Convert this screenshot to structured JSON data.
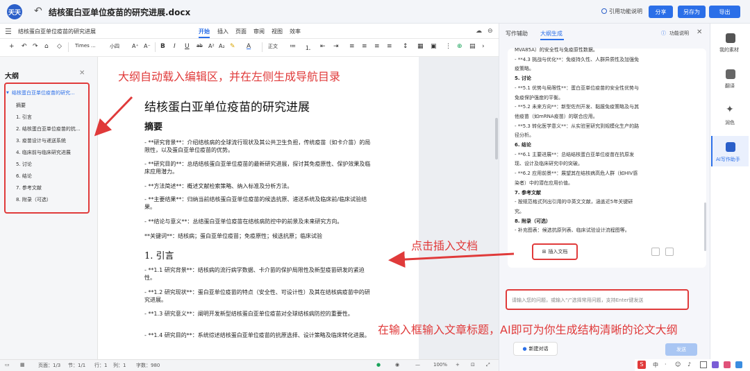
{
  "app": {
    "title": "结核蛋白亚单位疫苗的研究进展.docx",
    "logo_text": "天天"
  },
  "topbar": {
    "cite_help": "引用功能说明",
    "share": "分享",
    "save_as": "另存为",
    "export": "导出"
  },
  "toolbar_row1": {
    "doc_name": "结核蛋白亚单位疫苗的研究进展",
    "menus": [
      "开始",
      "插入",
      "页面",
      "审阅",
      "视图",
      "效率"
    ]
  },
  "toolbar_row2": {
    "font": "Times ...",
    "size": "小四",
    "style": "正文"
  },
  "outline": {
    "title": "大纲",
    "items": [
      "结核蛋白亚单位疫苗的研究...",
      "摘要",
      "1. 引言",
      "2. 结核蛋白亚单位疫苗的抗...",
      "3. 疫苗设计与递送系统",
      "4. 临床前与临床研究进展",
      "5. 讨论",
      "6. 结论",
      "7. 参考文献",
      "8. 附录（可选）"
    ]
  },
  "document": {
    "title": "结核蛋白亚单位疫苗的研究进展",
    "abstract_heading": "摘要",
    "abstract_paras": [
      "- **研究背景**：介绍结核病的全球流行现状及其公共卫生负担，传统疫苗（如卡介苗）的局限性，以及蛋白亚单位疫苗的优势。",
      "- **研究目的**：总结结核蛋白亚单位疫苗的最新研究进展，探讨其免疫原性、保护效果及临床应用潜力。",
      "- **方法简述**：概述文献检索策略、纳入标准及分析方法。",
      "- **主要结果**：归纳当前结核蛋白亚单位疫苗的候选抗原、递送系统及临床前/临床试验结果。",
      "- **结论与意义**：总结蛋白亚单位疫苗在结核病防控中的前景及未来研究方向。",
      "**关键词**：结核病；蛋白亚单位疫苗；免疫原性；候选抗原；临床试验"
    ],
    "intro_heading": "1.   引言",
    "intro_paras": [
      "- **1.1 研究背景**：结核病的流行病学数据、卡介苗的保护局限性及新型疫苗研发的紧迫性。",
      "- **1.2 研究现状**：蛋白亚单位疫苗的特点（安全性、可设计性）及其在结核病疫苗中的研究进展。",
      "- **1.3 研究意义**：阐明开发新型结核蛋白亚单位疫苗对全球结核病防控的重要性。",
      "- **1.4 研究目的**：系统综述结核蛋白亚单位疫苗的抗原选择、设计策略及临床转化进展。"
    ]
  },
  "status": {
    "page": "页面：1/3",
    "section": "节：1/1",
    "row": "行：1",
    "col": "列：1",
    "words": "字数：980",
    "zoom": "100%"
  },
  "right_panel": {
    "tabs": [
      "写作辅助",
      "大纲生成"
    ],
    "help": "功能说明",
    "lines": [
      {
        "t": "MVA85A）的安全性与免疫原性数据。",
        "b": false
      },
      {
        "t": "- **4.3 挑战与优化**：免疫持久性、人群异质性及加强免",
        "b": false
      },
      {
        "t": "疫策略。",
        "b": false
      },
      {
        "t": "5. 讨论",
        "b": true
      },
      {
        "t": "- **5.1 优势与局限性**：蛋白亚单位疫苗的安全性优势与",
        "b": false
      },
      {
        "t": "免疫保护强度的平衡。",
        "b": false
      },
      {
        "t": "- **5.2 未来方向**：新型佐剂开发、黏膜免疫策略及与其",
        "b": false
      },
      {
        "t": "他疫苗（如mRNA疫苗）的联合应用。",
        "b": false
      },
      {
        "t": "- **5.3 转化医学意义**：从实验室研究到规模化生产的路",
        "b": false
      },
      {
        "t": "径分析。",
        "b": false
      },
      {
        "t": "6. 结论",
        "b": true
      },
      {
        "t": "- **6.1 主要进展**：总结结核蛋白亚单位疫苗在抗原发",
        "b": false
      },
      {
        "t": "现、设计及临床研究中的突破。",
        "b": false
      },
      {
        "t": "- **6.2 应用前景**：展望其在结核病高危人群（如HIV感",
        "b": false
      },
      {
        "t": "染者）中的潜在应用价值。",
        "b": false
      },
      {
        "t": "7. 参考文献",
        "b": true
      },
      {
        "t": "- 按规范格式列出引用的中英文文献，涵盖近5年关键研",
        "b": false
      },
      {
        "t": "究。",
        "b": false
      },
      {
        "t": "8. 附录（可选）",
        "b": true
      },
      {
        "t": "- 补充图表：候选抗原列表、临床试验设计流程图等。",
        "b": false
      }
    ],
    "insert_doc": "插入文档",
    "input_placeholder": "请输入您的问题，或输入“/”选择常用问题，支持Enter键发送",
    "new_chat": "新建对话",
    "send": "发送"
  },
  "rail": {
    "items": [
      "我的素材",
      "翻译",
      "润色",
      "AI写作助手"
    ]
  },
  "annotations": {
    "a1": "大纲自动载入编辑区，并在左侧生成导航目录",
    "a2": "点击插入文档",
    "a3": "在输入框输入文章标题，AI即可为你生成结构清晰的论文大纲"
  },
  "tray": [
    "中",
    "·",
    "☺",
    "♪"
  ],
  "colors": {
    "accent": "#2b6fe8",
    "annotation": "#e03a3a"
  }
}
